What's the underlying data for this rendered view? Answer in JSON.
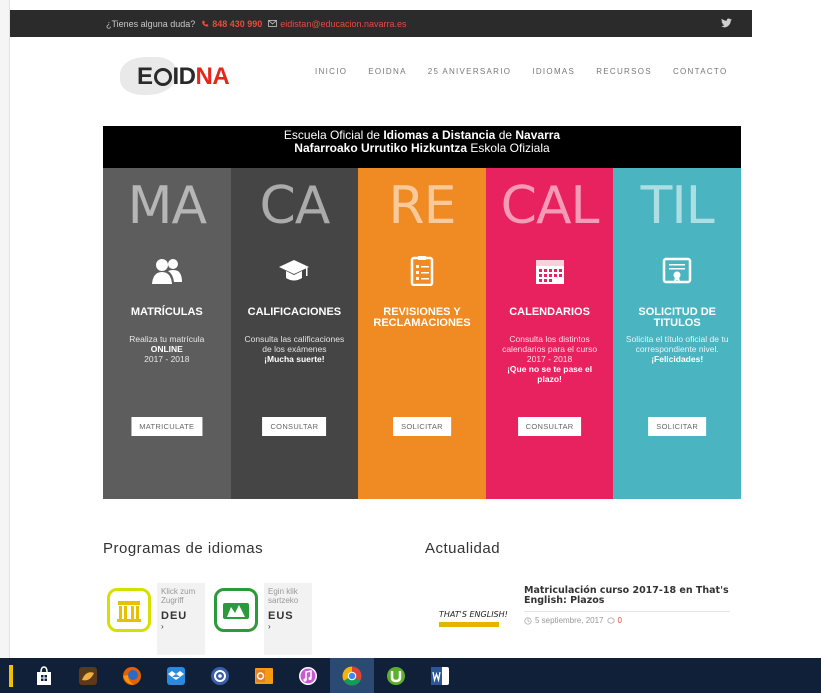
{
  "topbar": {
    "question": "¿Tienes alguna duda?",
    "phone": "848 430 990",
    "email": "eidistan@educacion.navarra.es"
  },
  "logo": {
    "text_e": "E",
    "text_id": "ID",
    "text_na": "NA"
  },
  "nav": [
    "INICIO",
    "EOIDNA",
    "25 ANIVERSARIO",
    "IDIOMAS",
    "RECURSOS",
    "CONTACTO"
  ],
  "banner": {
    "line1_a": "Escuela Oficial ",
    "line1_b": "de ",
    "line1_bold1": "Idiomas a Distancia",
    "line1_c": " de ",
    "line1_bold2": "Navarra",
    "line2_bold": "Nafarroako Urrutiko Hizkuntza",
    "line2_c": " Eskola Ofiziala"
  },
  "columns": [
    {
      "big": "MA",
      "title": "MATRÍCULAS",
      "desc1": "Realiza tu matrícula",
      "desc_bold": "ONLINE",
      "desc2": "2017 - 2018",
      "button": "MATRICULATE",
      "color": "#5d5d5d",
      "icon": "users-icon"
    },
    {
      "big": "CA",
      "title": "CALIFICACIONES",
      "desc1": "Consulta las calificaciones de los exámenes",
      "desc_bold": "¡Mucha suerte!",
      "desc2": "",
      "button": "CONSULTAR",
      "color": "#454545",
      "icon": "graduation-cap-icon"
    },
    {
      "big": "RE",
      "title": "REVISIONES Y RECLAMACIONES",
      "desc1": "",
      "desc_bold": "",
      "desc2": "",
      "button": "SOLICITAR",
      "color": "#f08a22",
      "icon": "clipboard-icon"
    },
    {
      "big": "CAL",
      "title": "CALENDARIOS",
      "desc1": "Consulta los distintos calendarios para el curso 2017 - 2018",
      "desc_bold": "¡Que no se te pase el plazo!",
      "desc2": "",
      "button": "CONSULTAR",
      "color": "#e8215f",
      "icon": "calendar-icon"
    },
    {
      "big": "TIL",
      "title": "SOLICITUD DE TITULOS",
      "desc1": "Solicita el título oficial de tu correspondiente nivel.",
      "desc_bold": "¡Felicidades!",
      "desc2": "",
      "button": "SOLICITAR",
      "color": "#4ab5c1",
      "icon": "certificate-icon"
    }
  ],
  "programs": {
    "title": "Programas de idiomas",
    "items": [
      {
        "small": "Klick zum Zugriff",
        "code": "DEU",
        "arrow": "›",
        "color": "#d6e000"
      },
      {
        "small": "Egin klik sartzeko",
        "code": "EUS",
        "arrow": "›",
        "color": "#2a9a3a"
      }
    ]
  },
  "news": {
    "title": "Actualidad",
    "thumb_text": "THAT'S ENGLISH!",
    "item_title": "Matriculación curso 2017-18 en That's English: Plazos",
    "date": "5 septiembre, 2017",
    "comments": "0"
  },
  "taskbar": [
    "store-icon",
    "app-icon",
    "firefox-icon",
    "dropbox-icon",
    "settings-icon",
    "outlook-icon",
    "itunes-icon",
    "chrome-icon",
    "utorrent-icon",
    "word-icon"
  ]
}
